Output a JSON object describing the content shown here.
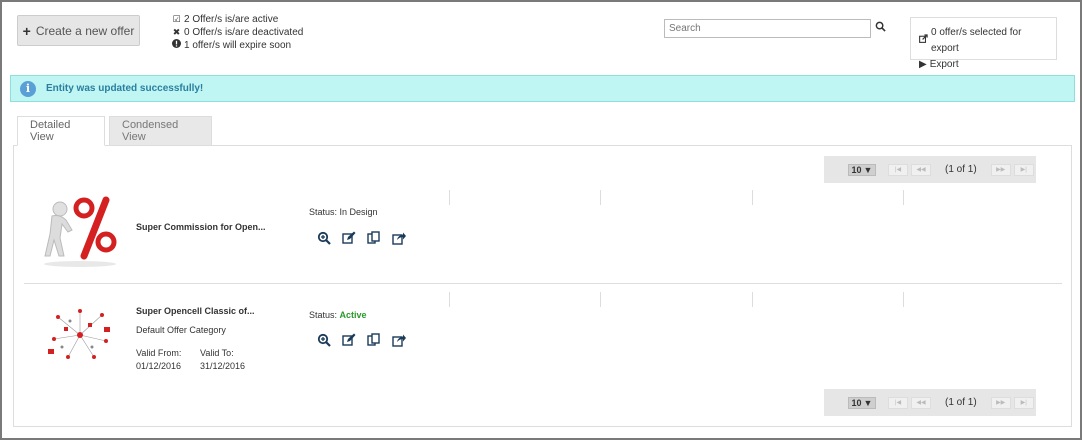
{
  "toolbar": {
    "create_label": "Create a new offer",
    "summary": [
      {
        "icon": "check-square-icon",
        "text": "2 Offer/s is/are active"
      },
      {
        "icon": "x-icon",
        "text": "0 Offer/s is/are deactivated"
      },
      {
        "icon": "exclamation-circle-icon",
        "text": "1 offer/s will expire soon"
      }
    ],
    "search_placeholder": "Search",
    "export_selected": "0 offer/s selected for export",
    "export_label": "Export"
  },
  "alert": {
    "message": "Entity was updated successfully!"
  },
  "tabs": [
    {
      "label": "Detailed View",
      "active": true
    },
    {
      "label": "Condensed View",
      "active": false
    }
  ],
  "pager": {
    "page_size": "10",
    "page_info": "(1 of 1)"
  },
  "offers": [
    {
      "title": "Super Commission for Open...",
      "status_label": "Status:",
      "status_value": "In Design",
      "category": "",
      "valid_from_label": "",
      "valid_from": "",
      "valid_to_label": "",
      "valid_to": ""
    },
    {
      "title": "Super Opencell Classic of...",
      "status_label": "Status:",
      "status_value": "Active",
      "category": "Default Offer Category",
      "valid_from_label": "Valid From:",
      "valid_from": "01/12/2016",
      "valid_to_label": "Valid To:",
      "valid_to": "31/12/2016"
    }
  ],
  "colors": {
    "alert_bg": "#bff5f2",
    "alert_text": "#2a7fa0",
    "status_active": "#2a9a2a",
    "action_icon": "#1a3a5a"
  }
}
